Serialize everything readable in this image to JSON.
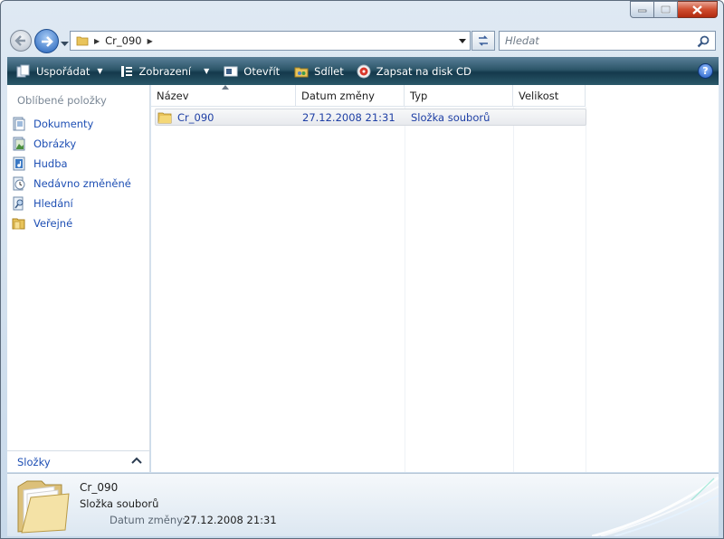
{
  "window": {
    "colors": {
      "accent": "#1e4fb4",
      "toolbar": "#2c5669",
      "close": "#cf4d2f"
    }
  },
  "address_bar": {
    "crumbs": [
      "Cr_090"
    ]
  },
  "search": {
    "placeholder": "Hledat"
  },
  "toolbar": {
    "organize_label": "Uspořádat",
    "views_label": "Zobrazení",
    "open_label": "Otevřít",
    "share_label": "Sdílet",
    "burn_label": "Zapsat na disk CD"
  },
  "sidebar": {
    "title": "Oblíbené položky",
    "items": [
      {
        "label": "Dokumenty",
        "icon": "documents-icon"
      },
      {
        "label": "Obrázky",
        "icon": "pictures-icon"
      },
      {
        "label": "Hudba",
        "icon": "music-icon"
      },
      {
        "label": "Nedávno změněné",
        "icon": "recent-icon"
      },
      {
        "label": "Hledání",
        "icon": "searches-icon"
      },
      {
        "label": "Veřejné",
        "icon": "public-folder-icon"
      }
    ],
    "folders_label": "Složky"
  },
  "file_list": {
    "columns": [
      "Název",
      "Datum změny",
      "Typ",
      "Velikost"
    ],
    "rows": [
      {
        "name": "Cr_090",
        "date": "27.12.2008 21:31",
        "type": "Složka souborů",
        "size": ""
      }
    ]
  },
  "details": {
    "name": "Cr_090",
    "type": "Složka souborů",
    "date_label": "Datum změny:",
    "date_value": "27.12.2008 21:31"
  }
}
